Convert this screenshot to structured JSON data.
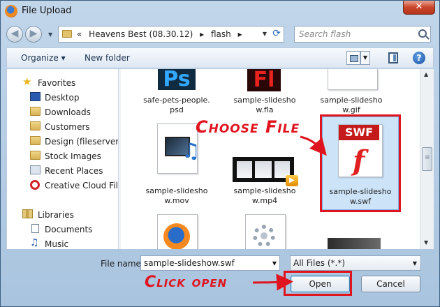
{
  "window": {
    "title": "File Upload",
    "close_glyph": "✕"
  },
  "nav": {
    "back_glyph": "◀",
    "forward_glyph": "▶",
    "dropdown_glyph": "▼",
    "breadcrumb": [
      "«",
      "Heavens Best (08.30.12)",
      "▸",
      "flash",
      "▸"
    ],
    "refresh_glyph": "⟳",
    "search_placeholder": "Search flash"
  },
  "toolbar": {
    "organize_label": "Organize ▾",
    "new_folder_label": "New folder",
    "dd_glyph": "▼",
    "help_label": "?"
  },
  "sidebar": {
    "favorites_label": "Favorites",
    "items": [
      {
        "label": "Desktop",
        "icon": "desktop-icon"
      },
      {
        "label": "Downloads",
        "icon": "folder-icon"
      },
      {
        "label": "Customers",
        "icon": "folder-icon"
      },
      {
        "label": "Design (fileserver)",
        "icon": "folder-icon"
      },
      {
        "label": "Stock Images",
        "icon": "folder-icon"
      },
      {
        "label": "Recent Places",
        "icon": "recent-places-icon"
      },
      {
        "label": "Creative Cloud Files",
        "icon": "creative-cloud-icon"
      }
    ],
    "libraries_label": "Libraries",
    "library_items": [
      {
        "label": "Documents",
        "icon": "documents-icon"
      },
      {
        "label": "Music",
        "icon": "music-icon"
      }
    ]
  },
  "files": [
    {
      "name_line1": "safe-pets-people.",
      "name_line2": "psd",
      "icon": "photoshop-file-icon",
      "badge": "Ps"
    },
    {
      "name_line1": "sample-slidesho",
      "name_line2": "w.fla",
      "icon": "flash-fla-file-icon",
      "badge": "Fl"
    },
    {
      "name_line1": "sample-slidesho",
      "name_line2": "w.gif",
      "icon": "gif-file-icon"
    },
    {
      "name_line1": "sample-slidesho",
      "name_line2": "w.mov",
      "icon": "quicktime-file-icon"
    },
    {
      "name_line1": "sample-slidesho",
      "name_line2": "w.mp4",
      "icon": "video-file-icon",
      "badge": "▶"
    },
    {
      "name_line1": "sample-slidesho",
      "name_line2": "w.swf",
      "icon": "swf-file-icon",
      "badge": "SWF",
      "selected": true
    },
    {
      "name_line1": "",
      "name_line2": "",
      "icon": "firefox-html-file-icon"
    },
    {
      "name_line1": "",
      "name_line2": "",
      "icon": "settings-file-icon"
    },
    {
      "name_line1": "",
      "name_line2": "",
      "icon": "image-file-icon"
    }
  ],
  "flash_glyph": "f",
  "music_glyph": "♫",
  "star_glyph": "★",
  "bottom": {
    "file_name_label": "File name:",
    "file_name_value": "sample-slideshow.swf",
    "file_type_value": "All Files (*.*)",
    "open_label": "Open",
    "cancel_label": "Cancel"
  },
  "annotations": {
    "choose_file": "Choose File",
    "click_open": "Click open"
  },
  "colors": {
    "annotation_red": "#e0141e",
    "selection_blue": "#cde4f8"
  }
}
